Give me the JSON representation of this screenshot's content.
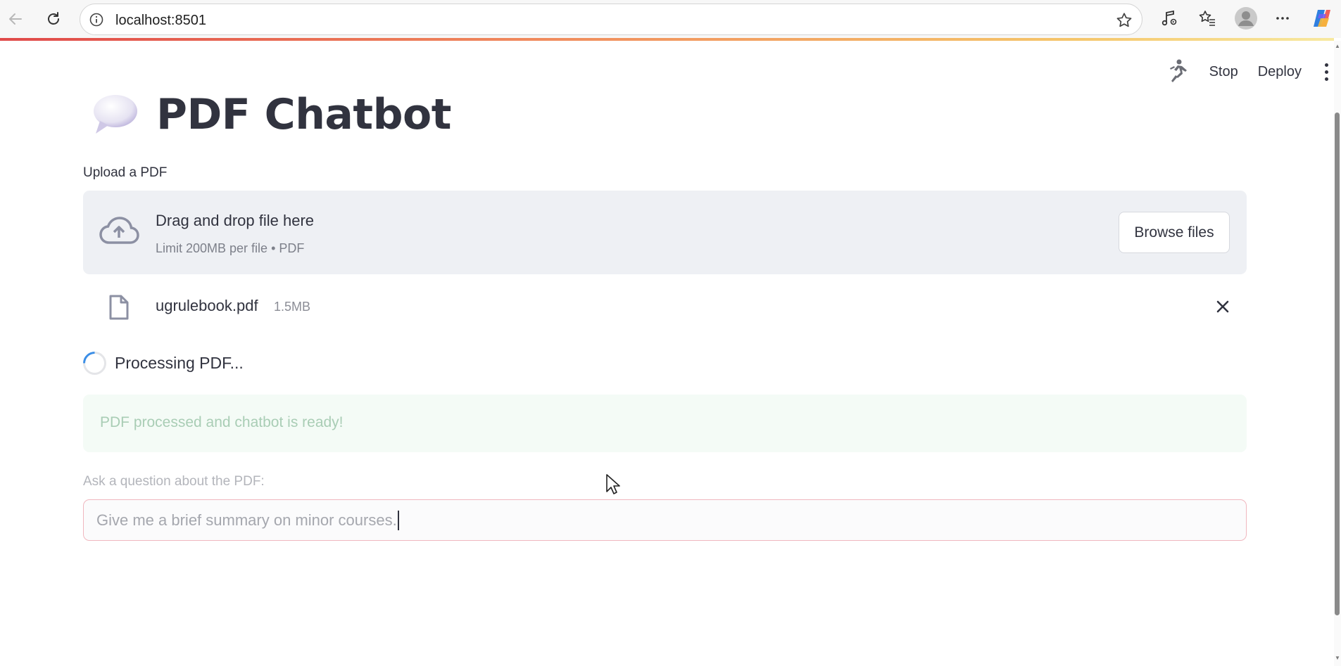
{
  "browser": {
    "address": "localhost:8501"
  },
  "header": {
    "stop_label": "Stop",
    "deploy_label": "Deploy"
  },
  "page": {
    "title": "PDF Chatbot",
    "title_icon": "speech-balloon-emoji"
  },
  "uploader": {
    "label": "Upload a PDF",
    "drop_title": "Drag and drop file here",
    "drop_subtitle": "Limit 200MB per file • PDF",
    "browse_label": "Browse files"
  },
  "file": {
    "name": "ugrulebook.pdf",
    "size": "1.5MB"
  },
  "status": {
    "processing": "Processing PDF...",
    "success": "PDF processed and chatbot is ready!"
  },
  "question": {
    "label": "Ask a question about the PDF:",
    "value": "Give me a brief summary on minor courses."
  },
  "colors": {
    "text": "#31333f",
    "dropzone_bg": "#eef0f4",
    "success_bg": "#f4fbf6",
    "input_border": "#f0b7bf",
    "spinner": "#3b8ee6"
  }
}
